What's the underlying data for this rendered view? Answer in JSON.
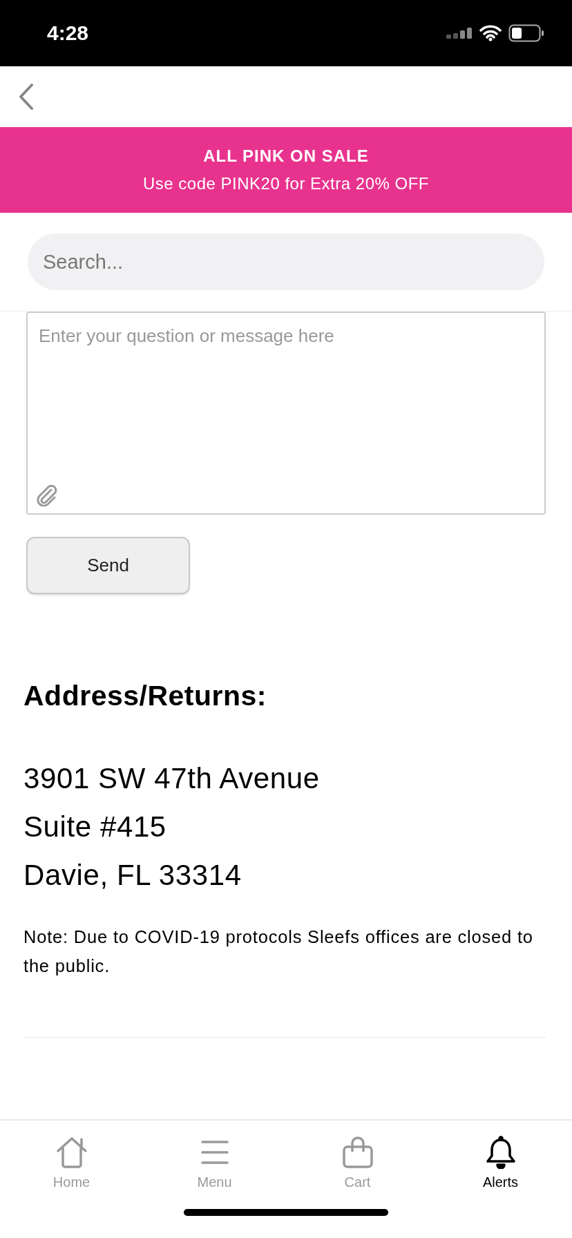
{
  "status_bar": {
    "time": "4:28"
  },
  "promo_banner": {
    "title": "ALL PINK ON SALE",
    "subtitle": "Use code PINK20 for Extra 20% OFF"
  },
  "search": {
    "placeholder": "Search..."
  },
  "message_form": {
    "placeholder": "Enter your question or message here",
    "send_button": "Send"
  },
  "address": {
    "heading": "Address/Returns:",
    "lines": [
      "3901 SW 47th Avenue",
      "Suite #415",
      "Davie, FL 33314"
    ],
    "note": "Note: Due to COVID-19 protocols Sleefs offices are closed to the public."
  },
  "tab_bar": [
    {
      "kind": "home",
      "label": "Home",
      "selected": false
    },
    {
      "kind": "menu",
      "label": "Menu",
      "selected": false
    },
    {
      "kind": "cart",
      "label": "Cart",
      "selected": false
    },
    {
      "kind": "alerts",
      "label": "Alerts",
      "selected": true
    }
  ]
}
